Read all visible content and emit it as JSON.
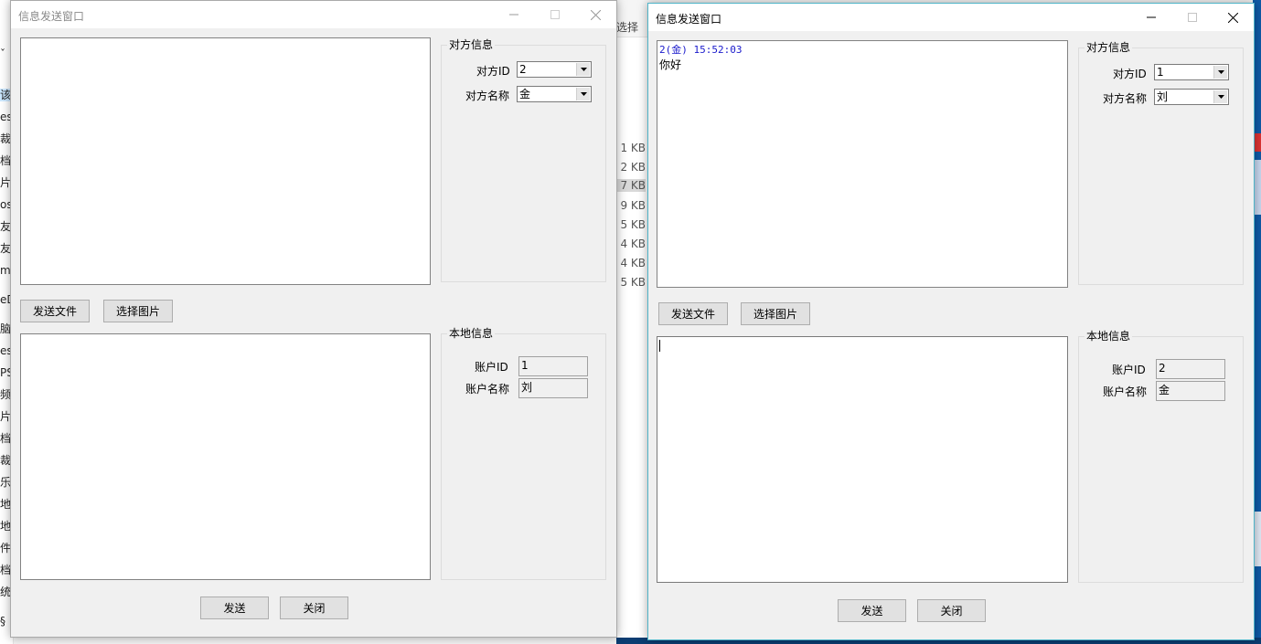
{
  "background": {
    "left_fragments": [
      "ˇ",
      "该",
      "esk",
      "裁",
      "档",
      "片",
      "osl",
      "友",
      "友",
      "mc",
      "eD",
      "脑",
      "esk",
      "PS",
      "频",
      "片",
      "档",
      "裁",
      "乐",
      "地",
      "地",
      "件",
      "档",
      "统",
      "§"
    ],
    "mid_label": "选择",
    "size_column": [
      "1 KB",
      "2 KB",
      "7 KB",
      "9 KB",
      "5 KB",
      "4 KB",
      "4 KB",
      "5 KB"
    ]
  },
  "window_left": {
    "title": "信息发送窗口",
    "state": "inactive",
    "history_messages": [],
    "compose_text": "",
    "send_file_label": "发送文件",
    "choose_image_label": "选择图片",
    "peer": {
      "group_title": "对方信息",
      "id_label": "对方ID",
      "id_value": "2",
      "name_label": "对方名称",
      "name_value": "金"
    },
    "local": {
      "group_title": "本地信息",
      "id_label": "账户ID",
      "id_value": "1",
      "name_label": "账户名称",
      "name_value": "刘"
    },
    "send_label": "发送",
    "close_label": "关闭"
  },
  "window_right": {
    "title": "信息发送窗口",
    "state": "active",
    "history_messages": [
      {
        "meta": "2(金) 15:52:03",
        "text": "你好"
      }
    ],
    "compose_text": "",
    "send_file_label": "发送文件",
    "choose_image_label": "选择图片",
    "peer": {
      "group_title": "对方信息",
      "id_label": "对方ID",
      "id_value": "1",
      "name_label": "对方名称",
      "name_value": "刘"
    },
    "local": {
      "group_title": "本地信息",
      "id_label": "账户ID",
      "id_value": "2",
      "name_label": "账户名称",
      "name_value": "金"
    },
    "send_label": "发送",
    "close_label": "关闭"
  },
  "colors": {
    "active_border": "#4fb4c8",
    "message_meta": "#1a1acc",
    "window_bg": "#f0f0f0"
  },
  "icons": [
    "minimize-icon",
    "maximize-icon",
    "close-icon",
    "dropdown-arrow-icon"
  ]
}
